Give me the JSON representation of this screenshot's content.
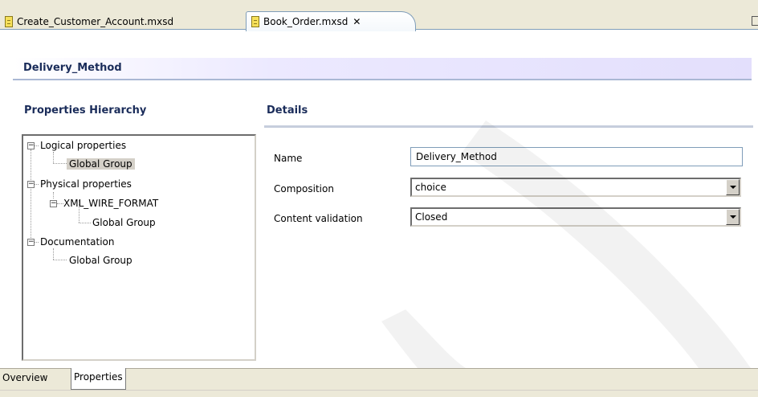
{
  "editor_tabs": [
    {
      "label": "Create_Customer_Account.mxsd",
      "icon": "document-icon",
      "active": false
    },
    {
      "label": "Book_Order.mxsd",
      "icon": "document-icon",
      "active": true,
      "close_glyph": "✕"
    }
  ],
  "section": {
    "title": "Delivery_Method"
  },
  "hierarchy": {
    "title": "Properties Hierarchy",
    "nodes": [
      {
        "label": "Logical properties",
        "expander": "−"
      },
      {
        "label": "Global Group",
        "selected": true
      },
      {
        "label": "Physical properties",
        "expander": "−"
      },
      {
        "label": "XML_WIRE_FORMAT",
        "expander": "−"
      },
      {
        "label": "Global Group"
      },
      {
        "label": "Documentation",
        "expander": "−"
      },
      {
        "label": "Global Group"
      }
    ]
  },
  "details": {
    "title": "Details",
    "fields": [
      {
        "label": "Name",
        "value": "Delivery_Method",
        "type": "text"
      },
      {
        "label": "Composition",
        "value": "choice",
        "type": "select"
      },
      {
        "label": "Content validation",
        "value": "Closed",
        "type": "select"
      }
    ]
  },
  "bottom_tabs": [
    {
      "label": "Overview",
      "active": false
    },
    {
      "label": "Properties",
      "active": true
    }
  ],
  "colors": {
    "tab_bar_bg": "#ece9d8",
    "header_gradient_end": "#e3dffc",
    "title_text": "#1a2c5a"
  }
}
